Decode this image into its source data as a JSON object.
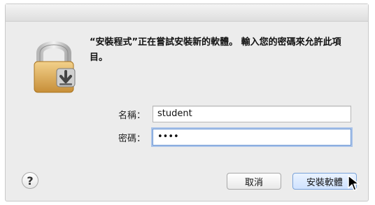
{
  "dialog": {
    "message": "“安裝程式”正在嘗試安裝新的軟體。 輸入您的密碼來允許此項目。",
    "username_label": "名稱：",
    "username_value": "student",
    "password_label": "密碼：",
    "password_value": "••••",
    "help_symbol": "?",
    "cancel_label": "取消",
    "install_label": "安裝軟體"
  },
  "icons": {
    "lock": "lock-icon",
    "cursor": "arrow-cursor-icon"
  },
  "colors": {
    "focus_ring": "#5b93e6",
    "primary_button": "#cfe2ff"
  }
}
